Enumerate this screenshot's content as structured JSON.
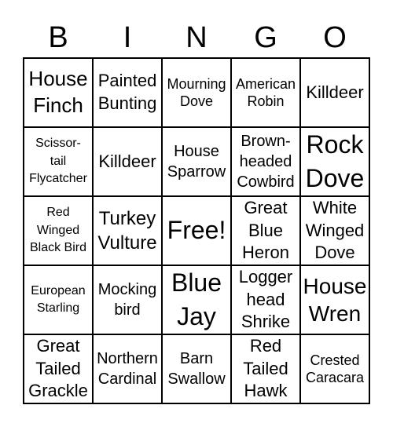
{
  "header": [
    "B",
    "I",
    "N",
    "G",
    "O"
  ],
  "cells": [
    "House\nFinch",
    "Painted\nBunting",
    "Mourning\nDove",
    "American\nRobin",
    "Killdeer",
    "Scissor-\ntail\nFlycatcher",
    "Killdeer",
    "House\nSparrow",
    "Brown-\nheaded\nCowbird",
    "Rock\nDove",
    "Red\nWinged\nBlack Bird",
    "Turkey\nVulture",
    "Free!",
    "Great\nBlue\nHeron",
    "White\nWinged\nDove",
    "European\nStarling",
    "Mocking\nbird",
    "Blue\nJay",
    "Logger\nhead\nShrike",
    "House\nWren",
    "Great\nTailed\nGrackle",
    "Northern\nCardinal",
    "Barn\nSwallow",
    "Red\nTailed\nHawk",
    "Crested\nCaracara"
  ]
}
